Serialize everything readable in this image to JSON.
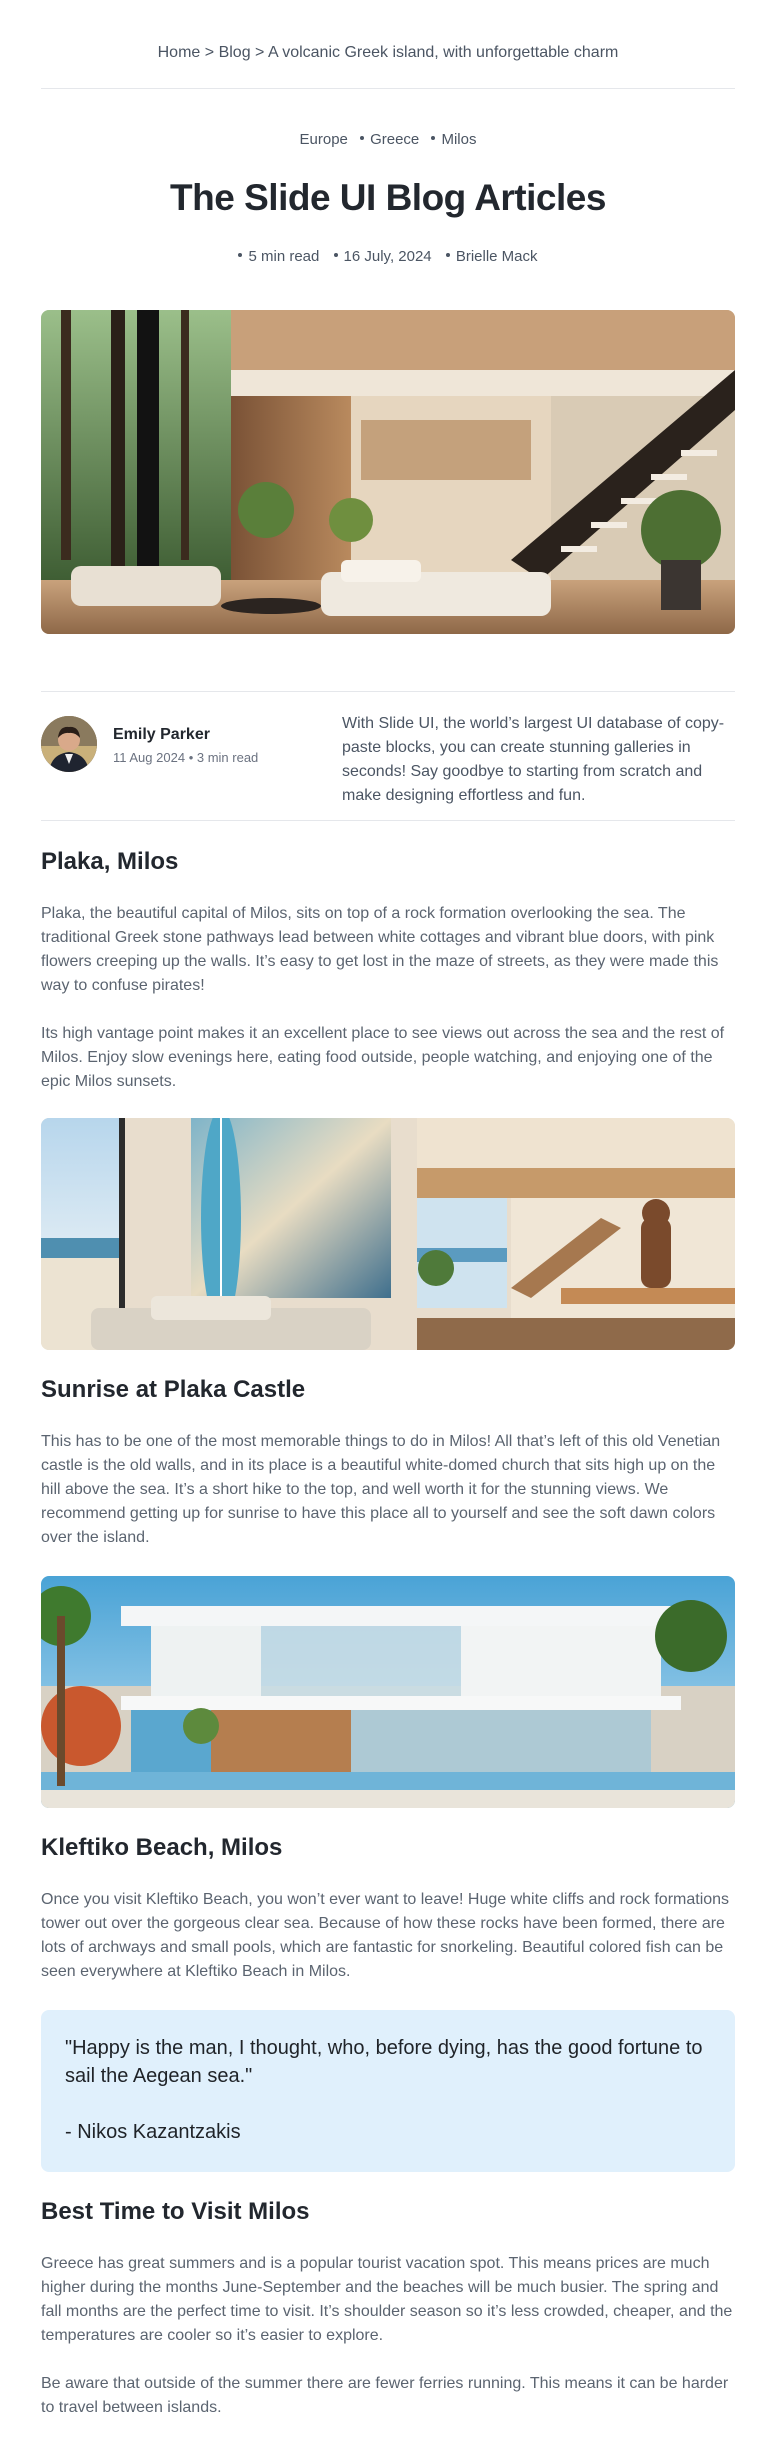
{
  "breadcrumb": {
    "home": "Home",
    "separator": ">",
    "blog": "Blog",
    "current": "A volcanic Greek island, with unforgettable charm"
  },
  "tags": [
    "Europe",
    "Greece",
    "Milos"
  ],
  "title": "The Slide UI Blog Articles",
  "meta": {
    "read_time": "5 min read",
    "date": "16 July, 2024",
    "author": "Brielle Mack"
  },
  "author_card": {
    "name": "Emily Parker",
    "date": "11 Aug 2024",
    "read_time": "3 min read",
    "blurb": "With Slide UI, the world’s largest UI database of copy-paste blocks, you can create stunning galleries in seconds! Say goodbye to starting from scratch and make designing effortless and fun."
  },
  "sections": [
    {
      "heading": "Plaka, Milos",
      "paragraphs": [
        "Plaka, the beautiful capital of Milos, sits on top of a rock formation overlooking the sea. The traditional Greek stone pathways lead between white cottages and vibrant blue doors, with pink flowers creeping up the walls. It’s easy to get lost in the maze of streets, as they were made this way to confuse pirates!",
        "Its high vantage point makes it an excellent place to see views out across the sea and the rest of Milos. Enjoy slow evenings here, eating food outside, people watching, and enjoying one of the epic Milos sunsets."
      ]
    },
    {
      "heading": "Sunrise at Plaka Castle",
      "paragraphs": [
        "This has to be one of the most memorable things to do in Milos! All that’s left of this old Venetian castle is the old walls, and in its place is a beautiful white-domed church that sits high up on the hill above the sea. It’s a short hike to the top, and well worth it for the stunning views. We recommend getting up for sunrise to have this place all to yourself and see the soft dawn colors over the island."
      ]
    },
    {
      "heading": "Kleftiko Beach, Milos",
      "paragraphs": [
        "Once you visit Kleftiko Beach, you won’t ever want to leave! Huge white cliffs and rock formations tower out over the gorgeous clear sea. Because of how these rocks have been formed, there are lots of archways and small pools, which are fantastic for snorkeling. Beautiful colored fish can be seen everywhere at Kleftiko Beach in Milos."
      ]
    },
    {
      "heading": "Best Time to Visit Milos",
      "paragraphs": [
        "Greece has great summers and is a popular tourist vacation spot. This means prices are much higher during the months June-September and the beaches will be much busier. The spring and fall months are the perfect time to visit. It’s shoulder season so it’s less crowded, cheaper, and the temperatures are cooler so it’s easier to explore.",
        "Be aware that outside of the summer there are fewer ferries running. This means it can be harder to travel between islands."
      ]
    }
  ],
  "quote": {
    "text": "\"Happy is the man, I thought, who, before dying, has the good fortune to sail the Aegean sea.\"",
    "attribution": "- Nikos Kazantzakis"
  },
  "colors": {
    "heading": "#22272e",
    "body_text": "#5b6470",
    "quote_bg": "#e0f0fc",
    "divider": "#e5e7eb"
  }
}
